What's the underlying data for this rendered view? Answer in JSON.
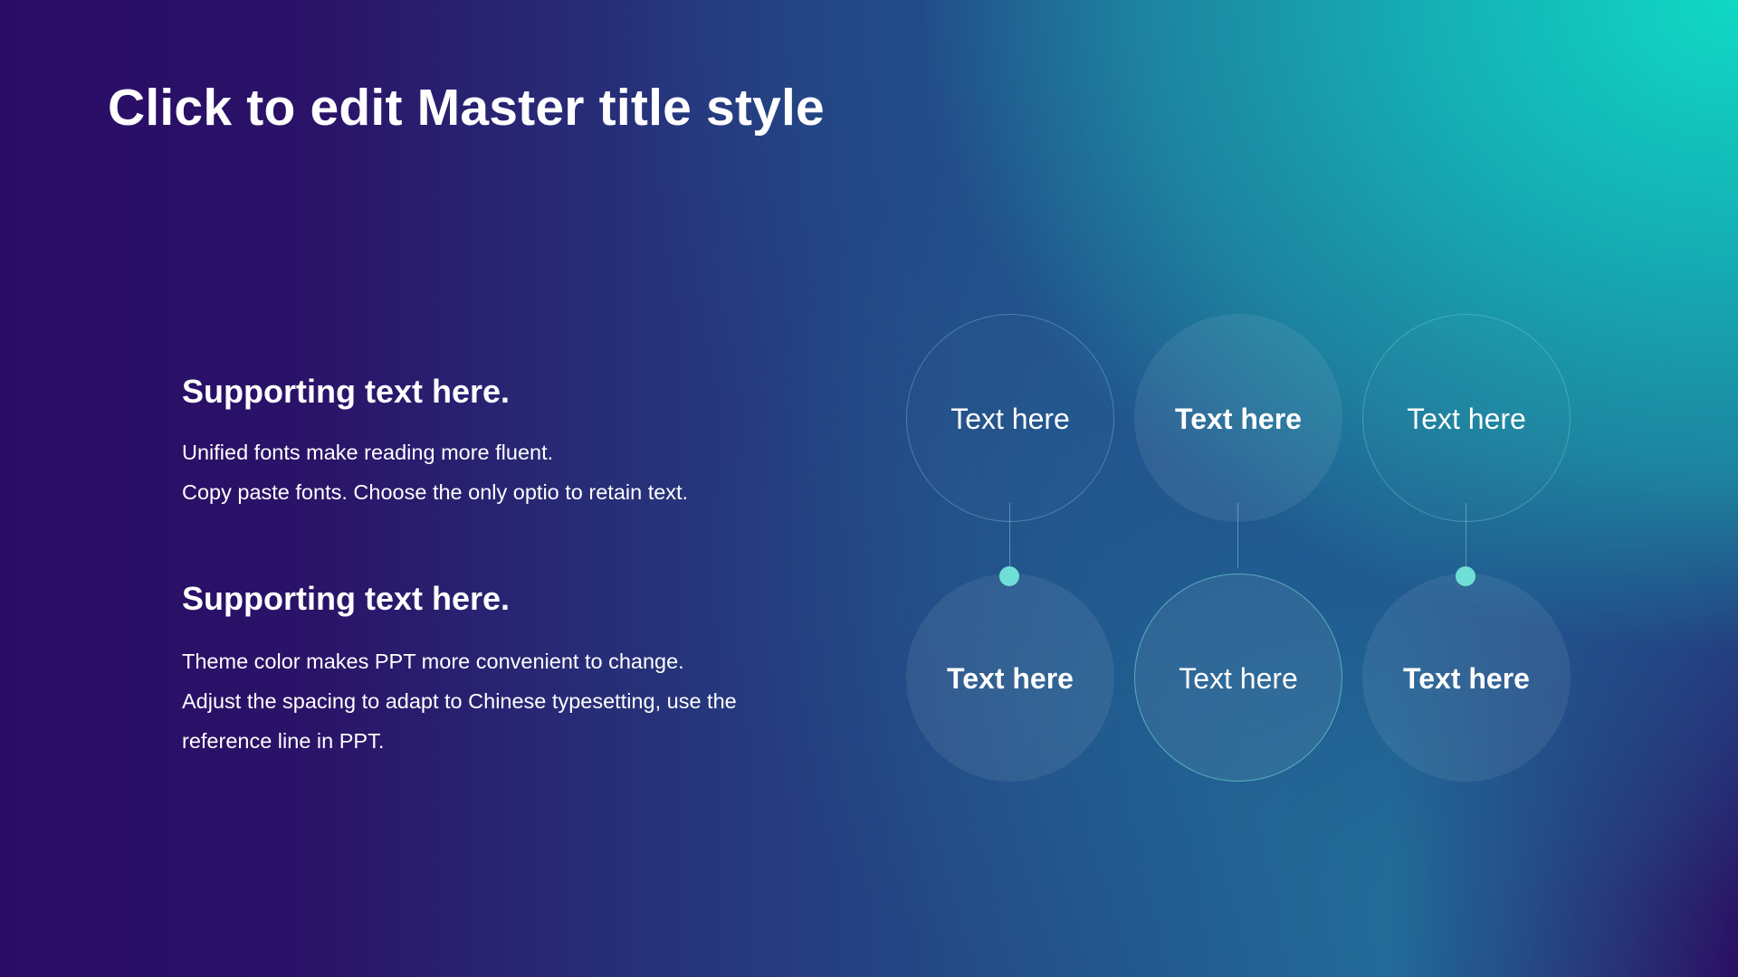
{
  "slide": {
    "title": "Click to edit Master title style"
  },
  "sections": [
    {
      "heading": "Supporting text here.",
      "lines": [
        "Unified fonts make reading more fluent.",
        "Copy paste fonts. Choose the only optio to retain text."
      ]
    },
    {
      "heading": "Supporting text here.",
      "lines": [
        "Theme color makes PPT more convenient to change.",
        "Adjust the spacing to adapt to Chinese typesetting, use the",
        "reference line in PPT."
      ]
    }
  ],
  "circles": {
    "top": [
      {
        "label": "Text here",
        "style": "outline"
      },
      {
        "label": "Text here",
        "style": "filled-bold"
      },
      {
        "label": "Text here",
        "style": "outline"
      }
    ],
    "bottom": [
      {
        "label": "Text here",
        "style": "filled-bold"
      },
      {
        "label": "Text here",
        "style": "outline-bright"
      },
      {
        "label": "Text here",
        "style": "filled-bold"
      }
    ]
  },
  "colors": {
    "background_dark": "#2b0b66",
    "background_accent": "#10d9c4",
    "dot": "#6fded6",
    "text": "#ffffff"
  }
}
